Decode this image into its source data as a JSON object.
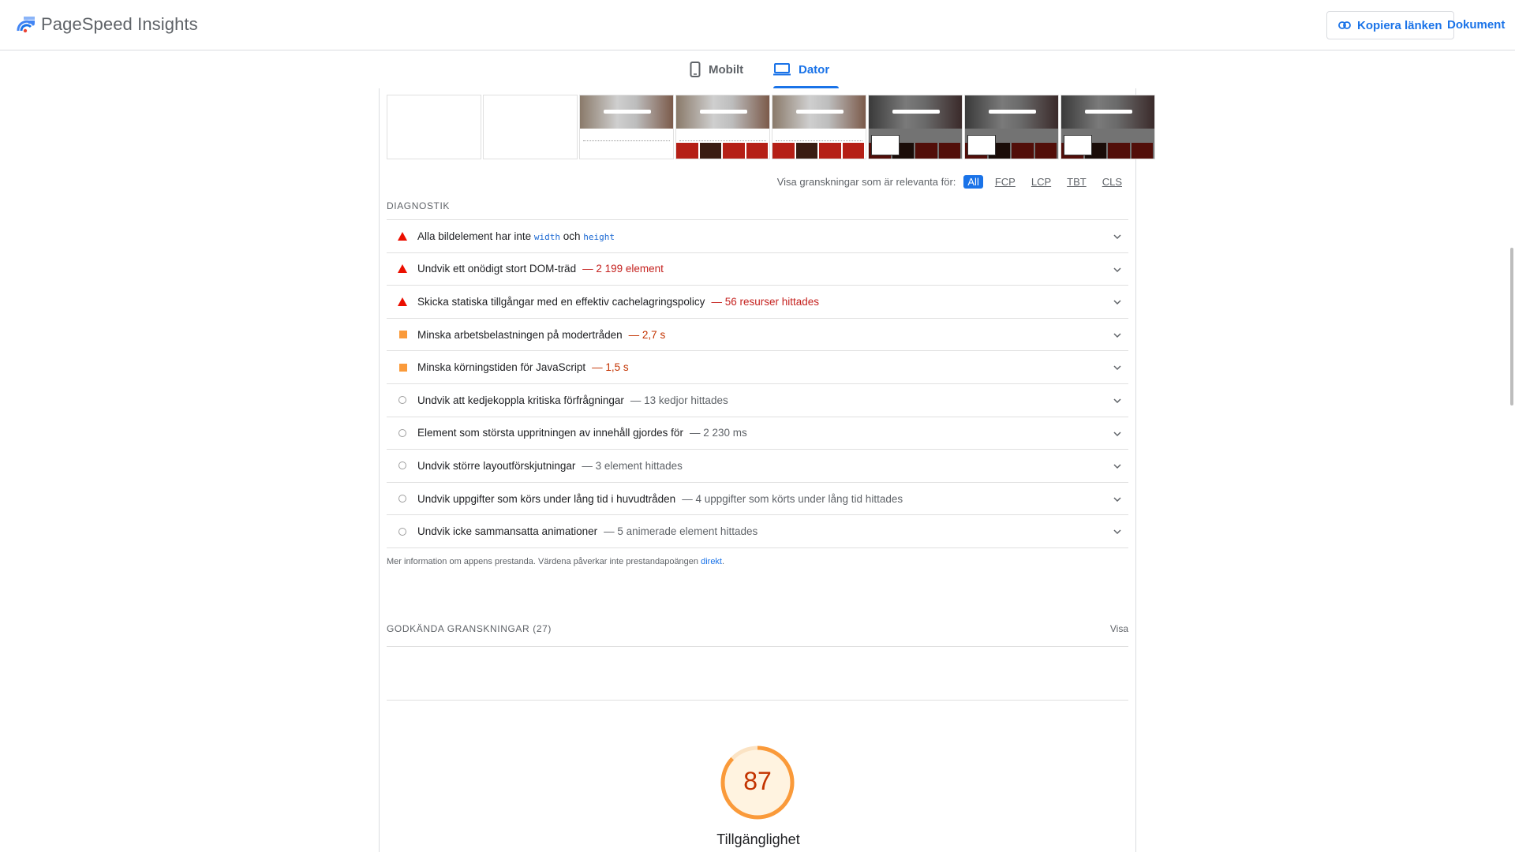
{
  "header": {
    "app_title": "PageSpeed Insights",
    "copy_link_label": "Kopiera länken",
    "docs_label": "Dokument"
  },
  "tabs": [
    {
      "label": "Mobilt",
      "icon": "phone-icon",
      "active": false
    },
    {
      "label": "Dator",
      "icon": "laptop-icon",
      "active": true
    }
  ],
  "filters": {
    "label": "Visa granskningar som är relevanta för:",
    "options": [
      "All",
      "FCP",
      "LCP",
      "TBT",
      "CLS"
    ],
    "selected": "All"
  },
  "diagnostics": {
    "title": "DIAGNOSTIK",
    "audits": [
      {
        "severity": "fail",
        "text_before": "Alla bildelement har inte ",
        "code1": "width",
        "mid": " och ",
        "code2": "height",
        "detail": ""
      },
      {
        "severity": "fail",
        "text": "Undvik ett onödigt stort DOM-träd",
        "detail": "— 2 199 element"
      },
      {
        "severity": "fail",
        "text": "Skicka statiska tillgångar med en effektiv cachelagringspolicy",
        "detail": "— 56 resurser hittades"
      },
      {
        "severity": "average",
        "text": "Minska arbetsbelastningen på modertråden",
        "detail": "— 2,7 s"
      },
      {
        "severity": "average",
        "text": "Minska körningstiden för JavaScript",
        "detail": "— 1,5 s"
      },
      {
        "severity": "info",
        "text": "Undvik att kedjekoppla kritiska förfrågningar",
        "detail": "— 13 kedjor hittades"
      },
      {
        "severity": "info",
        "text": "Element som största uppritningen av innehåll gjordes för",
        "detail": "— 2 230 ms"
      },
      {
        "severity": "info",
        "text": "Undvik större layoutförskjutningar",
        "detail": "— 3 element hittades"
      },
      {
        "severity": "info",
        "text": "Undvik uppgifter som körs under lång tid i huvudtråden",
        "detail": "— 4 uppgifter som körts under lång tid hittades"
      },
      {
        "severity": "info",
        "text": "Undvik icke sammansatta animationer",
        "detail": "— 5 animerade element hittades"
      }
    ],
    "footnote": "Mer information om appens prestanda. Värdena påverkar inte prestandapoängen",
    "footnote_link": "direkt",
    "footnote_end": "."
  },
  "passed": {
    "label": "GODKÄNDA GRANSKNINGAR",
    "count": "(27)",
    "show_label": "Visa"
  },
  "accessibility": {
    "score": "87",
    "score_fraction": 0.87,
    "label": "Tillgänglighet",
    "color": "#fa9a3a"
  },
  "colors": {
    "accent": "#1a73e8",
    "fail": "#eb0f00",
    "average": "#fa9a3a",
    "info": "#9e9e9e"
  }
}
